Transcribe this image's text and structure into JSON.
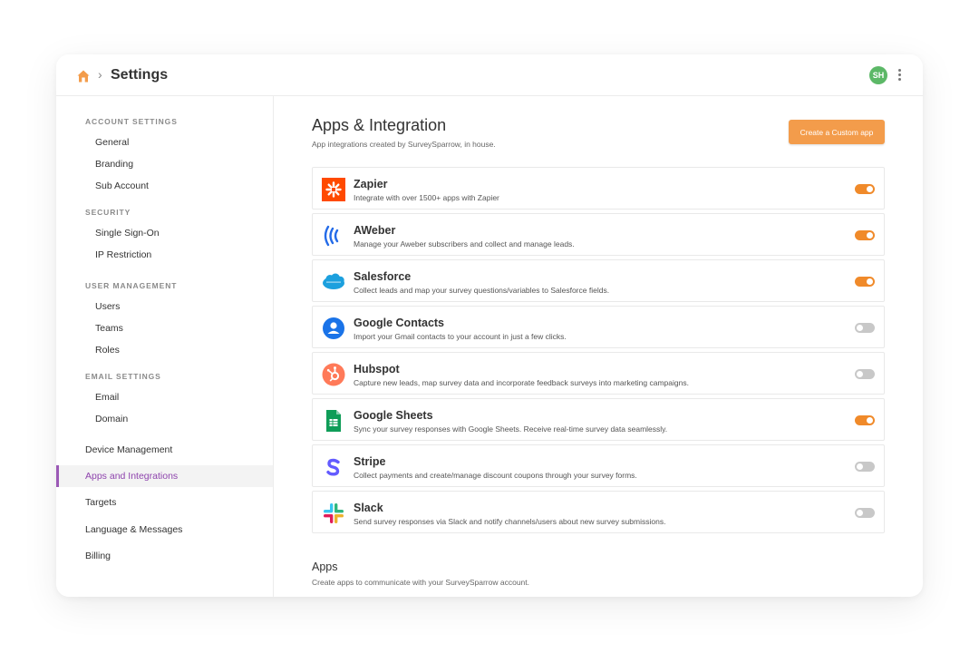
{
  "header": {
    "breadcrumb_sep": "›",
    "title": "Settings",
    "avatar_initials": "SH",
    "home_icon": "home-icon",
    "menu_icon": "kebab-menu-icon"
  },
  "sidebar": {
    "account_settings": {
      "heading": "ACCOUNT SETTINGS",
      "items": [
        "General",
        "Branding",
        "Sub Account"
      ]
    },
    "security": {
      "heading": "SECURITY",
      "items": [
        "Single Sign-On",
        "IP Restriction"
      ]
    },
    "user_management": {
      "heading": "USER MANAGEMENT",
      "items": [
        "Users",
        "Teams",
        "Roles"
      ]
    },
    "email_settings": {
      "heading": "EMAIL SETTINGS",
      "items": [
        "Email",
        "Domain"
      ]
    },
    "main_items": [
      "Device Management",
      "Apps and Integrations",
      "Targets",
      "Language & Messages",
      "Billing"
    ],
    "active_item": "Apps and Integrations"
  },
  "main": {
    "title": "Apps & Integration",
    "subtitle": "App integrations created by SurveySparrow, in house.",
    "custom_app_button": "Create a Custom app",
    "integrations": [
      {
        "name": "Zapier",
        "desc": "Integrate with over 1500+ apps with Zapier",
        "enabled": true,
        "icon": "zapier-icon"
      },
      {
        "name": "AWeber",
        "desc": "Manage your Aweber subscribers and collect and manage leads.",
        "enabled": true,
        "icon": "aweber-icon"
      },
      {
        "name": "Salesforce",
        "desc": "Collect leads and map your survey questions/variables to Salesforce fields.",
        "enabled": true,
        "icon": "salesforce-icon"
      },
      {
        "name": "Google Contacts",
        "desc": "Import your Gmail contacts to your account in just a few clicks.",
        "enabled": false,
        "icon": "google-contacts-icon"
      },
      {
        "name": "Hubspot",
        "desc": "Capture new leads, map survey data and incorporate feedback surveys into marketing campaigns.",
        "enabled": false,
        "icon": "hubspot-icon"
      },
      {
        "name": "Google Sheets",
        "desc": "Sync your survey responses with Google Sheets. Receive real-time survey data seamlessly.",
        "enabled": true,
        "icon": "google-sheets-icon"
      },
      {
        "name": "Stripe",
        "desc": "Collect payments and create/manage discount coupons through your survey forms.",
        "enabled": false,
        "icon": "stripe-icon"
      },
      {
        "name": "Slack",
        "desc": "Send survey responses via Slack and notify channels/users about new survey submissions.",
        "enabled": false,
        "icon": "slack-icon"
      }
    ],
    "apps_title": "Apps",
    "apps_subtitle": "Create apps to communicate with your SurveySparrow account."
  },
  "colors": {
    "accent": "#f39c4b",
    "toggle_on": "#f08a2a",
    "toggle_off": "#c8c8c8",
    "active_nav": "#8e44ad",
    "avatar_bg": "#5cb867"
  }
}
